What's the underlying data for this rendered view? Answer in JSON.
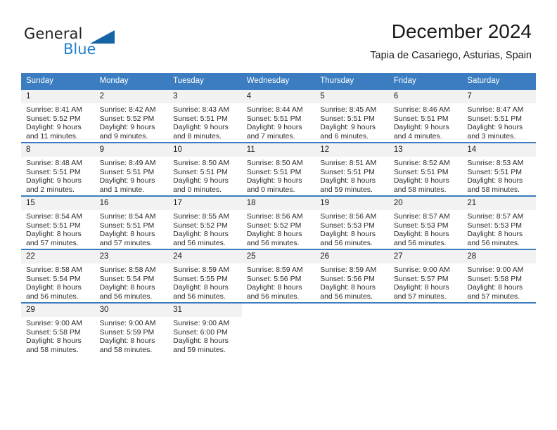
{
  "brand": {
    "name_part1": "General",
    "name_part2": "Blue",
    "accent_color": "#1464a5",
    "text_color": "#231f20"
  },
  "header": {
    "title": "December 2024",
    "subtitle": "Tapia de Casariego, Asturias, Spain"
  },
  "theme": {
    "header_row_bg": "#3b7dc0",
    "daynum_bg": "#f2f2f2",
    "cell_bg": "#ffffff",
    "text": "#2b2b2b"
  },
  "weekday_headers": [
    "Sunday",
    "Monday",
    "Tuesday",
    "Wednesday",
    "Thursday",
    "Friday",
    "Saturday"
  ],
  "weeks": [
    [
      {
        "day": "1",
        "sunrise": "Sunrise: 8:41 AM",
        "sunset": "Sunset: 5:52 PM",
        "daylight1": "Daylight: 9 hours",
        "daylight2": "and 11 minutes."
      },
      {
        "day": "2",
        "sunrise": "Sunrise: 8:42 AM",
        "sunset": "Sunset: 5:52 PM",
        "daylight1": "Daylight: 9 hours",
        "daylight2": "and 9 minutes."
      },
      {
        "day": "3",
        "sunrise": "Sunrise: 8:43 AM",
        "sunset": "Sunset: 5:51 PM",
        "daylight1": "Daylight: 9 hours",
        "daylight2": "and 8 minutes."
      },
      {
        "day": "4",
        "sunrise": "Sunrise: 8:44 AM",
        "sunset": "Sunset: 5:51 PM",
        "daylight1": "Daylight: 9 hours",
        "daylight2": "and 7 minutes."
      },
      {
        "day": "5",
        "sunrise": "Sunrise: 8:45 AM",
        "sunset": "Sunset: 5:51 PM",
        "daylight1": "Daylight: 9 hours",
        "daylight2": "and 6 minutes."
      },
      {
        "day": "6",
        "sunrise": "Sunrise: 8:46 AM",
        "sunset": "Sunset: 5:51 PM",
        "daylight1": "Daylight: 9 hours",
        "daylight2": "and 4 minutes."
      },
      {
        "day": "7",
        "sunrise": "Sunrise: 8:47 AM",
        "sunset": "Sunset: 5:51 PM",
        "daylight1": "Daylight: 9 hours",
        "daylight2": "and 3 minutes."
      }
    ],
    [
      {
        "day": "8",
        "sunrise": "Sunrise: 8:48 AM",
        "sunset": "Sunset: 5:51 PM",
        "daylight1": "Daylight: 9 hours",
        "daylight2": "and 2 minutes."
      },
      {
        "day": "9",
        "sunrise": "Sunrise: 8:49 AM",
        "sunset": "Sunset: 5:51 PM",
        "daylight1": "Daylight: 9 hours",
        "daylight2": "and 1 minute."
      },
      {
        "day": "10",
        "sunrise": "Sunrise: 8:50 AM",
        "sunset": "Sunset: 5:51 PM",
        "daylight1": "Daylight: 9 hours",
        "daylight2": "and 0 minutes."
      },
      {
        "day": "11",
        "sunrise": "Sunrise: 8:50 AM",
        "sunset": "Sunset: 5:51 PM",
        "daylight1": "Daylight: 9 hours",
        "daylight2": "and 0 minutes."
      },
      {
        "day": "12",
        "sunrise": "Sunrise: 8:51 AM",
        "sunset": "Sunset: 5:51 PM",
        "daylight1": "Daylight: 8 hours",
        "daylight2": "and 59 minutes."
      },
      {
        "day": "13",
        "sunrise": "Sunrise: 8:52 AM",
        "sunset": "Sunset: 5:51 PM",
        "daylight1": "Daylight: 8 hours",
        "daylight2": "and 58 minutes."
      },
      {
        "day": "14",
        "sunrise": "Sunrise: 8:53 AM",
        "sunset": "Sunset: 5:51 PM",
        "daylight1": "Daylight: 8 hours",
        "daylight2": "and 58 minutes."
      }
    ],
    [
      {
        "day": "15",
        "sunrise": "Sunrise: 8:54 AM",
        "sunset": "Sunset: 5:51 PM",
        "daylight1": "Daylight: 8 hours",
        "daylight2": "and 57 minutes."
      },
      {
        "day": "16",
        "sunrise": "Sunrise: 8:54 AM",
        "sunset": "Sunset: 5:51 PM",
        "daylight1": "Daylight: 8 hours",
        "daylight2": "and 57 minutes."
      },
      {
        "day": "17",
        "sunrise": "Sunrise: 8:55 AM",
        "sunset": "Sunset: 5:52 PM",
        "daylight1": "Daylight: 8 hours",
        "daylight2": "and 56 minutes."
      },
      {
        "day": "18",
        "sunrise": "Sunrise: 8:56 AM",
        "sunset": "Sunset: 5:52 PM",
        "daylight1": "Daylight: 8 hours",
        "daylight2": "and 56 minutes."
      },
      {
        "day": "19",
        "sunrise": "Sunrise: 8:56 AM",
        "sunset": "Sunset: 5:53 PM",
        "daylight1": "Daylight: 8 hours",
        "daylight2": "and 56 minutes."
      },
      {
        "day": "20",
        "sunrise": "Sunrise: 8:57 AM",
        "sunset": "Sunset: 5:53 PM",
        "daylight1": "Daylight: 8 hours",
        "daylight2": "and 56 minutes."
      },
      {
        "day": "21",
        "sunrise": "Sunrise: 8:57 AM",
        "sunset": "Sunset: 5:53 PM",
        "daylight1": "Daylight: 8 hours",
        "daylight2": "and 56 minutes."
      }
    ],
    [
      {
        "day": "22",
        "sunrise": "Sunrise: 8:58 AM",
        "sunset": "Sunset: 5:54 PM",
        "daylight1": "Daylight: 8 hours",
        "daylight2": "and 56 minutes."
      },
      {
        "day": "23",
        "sunrise": "Sunrise: 8:58 AM",
        "sunset": "Sunset: 5:54 PM",
        "daylight1": "Daylight: 8 hours",
        "daylight2": "and 56 minutes."
      },
      {
        "day": "24",
        "sunrise": "Sunrise: 8:59 AM",
        "sunset": "Sunset: 5:55 PM",
        "daylight1": "Daylight: 8 hours",
        "daylight2": "and 56 minutes."
      },
      {
        "day": "25",
        "sunrise": "Sunrise: 8:59 AM",
        "sunset": "Sunset: 5:56 PM",
        "daylight1": "Daylight: 8 hours",
        "daylight2": "and 56 minutes."
      },
      {
        "day": "26",
        "sunrise": "Sunrise: 8:59 AM",
        "sunset": "Sunset: 5:56 PM",
        "daylight1": "Daylight: 8 hours",
        "daylight2": "and 56 minutes."
      },
      {
        "day": "27",
        "sunrise": "Sunrise: 9:00 AM",
        "sunset": "Sunset: 5:57 PM",
        "daylight1": "Daylight: 8 hours",
        "daylight2": "and 57 minutes."
      },
      {
        "day": "28",
        "sunrise": "Sunrise: 9:00 AM",
        "sunset": "Sunset: 5:58 PM",
        "daylight1": "Daylight: 8 hours",
        "daylight2": "and 57 minutes."
      }
    ],
    [
      {
        "day": "29",
        "sunrise": "Sunrise: 9:00 AM",
        "sunset": "Sunset: 5:58 PM",
        "daylight1": "Daylight: 8 hours",
        "daylight2": "and 58 minutes."
      },
      {
        "day": "30",
        "sunrise": "Sunrise: 9:00 AM",
        "sunset": "Sunset: 5:59 PM",
        "daylight1": "Daylight: 8 hours",
        "daylight2": "and 58 minutes."
      },
      {
        "day": "31",
        "sunrise": "Sunrise: 9:00 AM",
        "sunset": "Sunset: 6:00 PM",
        "daylight1": "Daylight: 8 hours",
        "daylight2": "and 59 minutes."
      },
      {
        "day": "",
        "sunrise": "",
        "sunset": "",
        "daylight1": "",
        "daylight2": ""
      },
      {
        "day": "",
        "sunrise": "",
        "sunset": "",
        "daylight1": "",
        "daylight2": ""
      },
      {
        "day": "",
        "sunrise": "",
        "sunset": "",
        "daylight1": "",
        "daylight2": ""
      },
      {
        "day": "",
        "sunrise": "",
        "sunset": "",
        "daylight1": "",
        "daylight2": ""
      }
    ]
  ]
}
